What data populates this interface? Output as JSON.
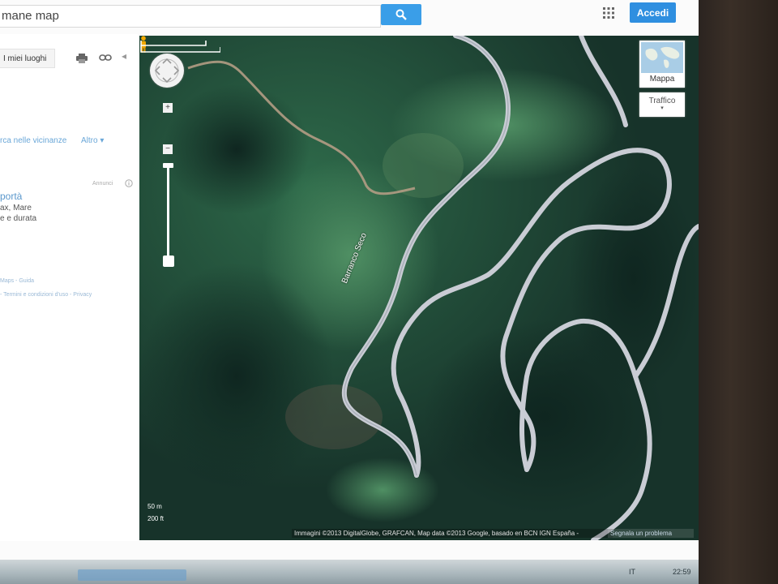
{
  "header": {
    "search_value": "mane map",
    "signin_label": "Accedi"
  },
  "left_panel": {
    "my_places_label": "I miei luoghi",
    "nearby_link": "rca nelle vicinanze",
    "more_link": "Altro",
    "more_arrow": "▾",
    "ads_label": "Annunci",
    "ad_title": "portà",
    "ad_line1": "ax, Mare",
    "ad_line2": "e e durata",
    "footer_line1": "Maps - Guida",
    "footer_line2": "- Termini e condizioni d'uso - Privacy"
  },
  "map": {
    "road_label": "Barranco Seco",
    "map_type_label": "Mappa",
    "traffic_label": "Traffico",
    "scale_metric": "50 m",
    "scale_imperial": "200 ft",
    "attribution": "Immagini ©2013 DigitalGlobe, GRAFCAN, Map data ©2013 Google, basado en BCN IGN España -",
    "report_problem": "Segnala un problema",
    "zoom_in": "+",
    "zoom_out": "−"
  },
  "taskbar": {
    "language": "IT",
    "clock": "22:59"
  },
  "colors": {
    "accent_blue": "#2f8fe0",
    "search_blue": "#3a9ee8",
    "road_color": "#c9ccd4",
    "forest_dark": "#1a3a2d",
    "forest_light": "#3a7a55"
  },
  "icons": {
    "search": "search-icon",
    "apps": "apps-grid-icon",
    "print": "print-icon",
    "link": "link-icon",
    "collapse": "collapse-arrow-icon",
    "pegman": "pegman-icon",
    "ads_info": "info-icon"
  }
}
